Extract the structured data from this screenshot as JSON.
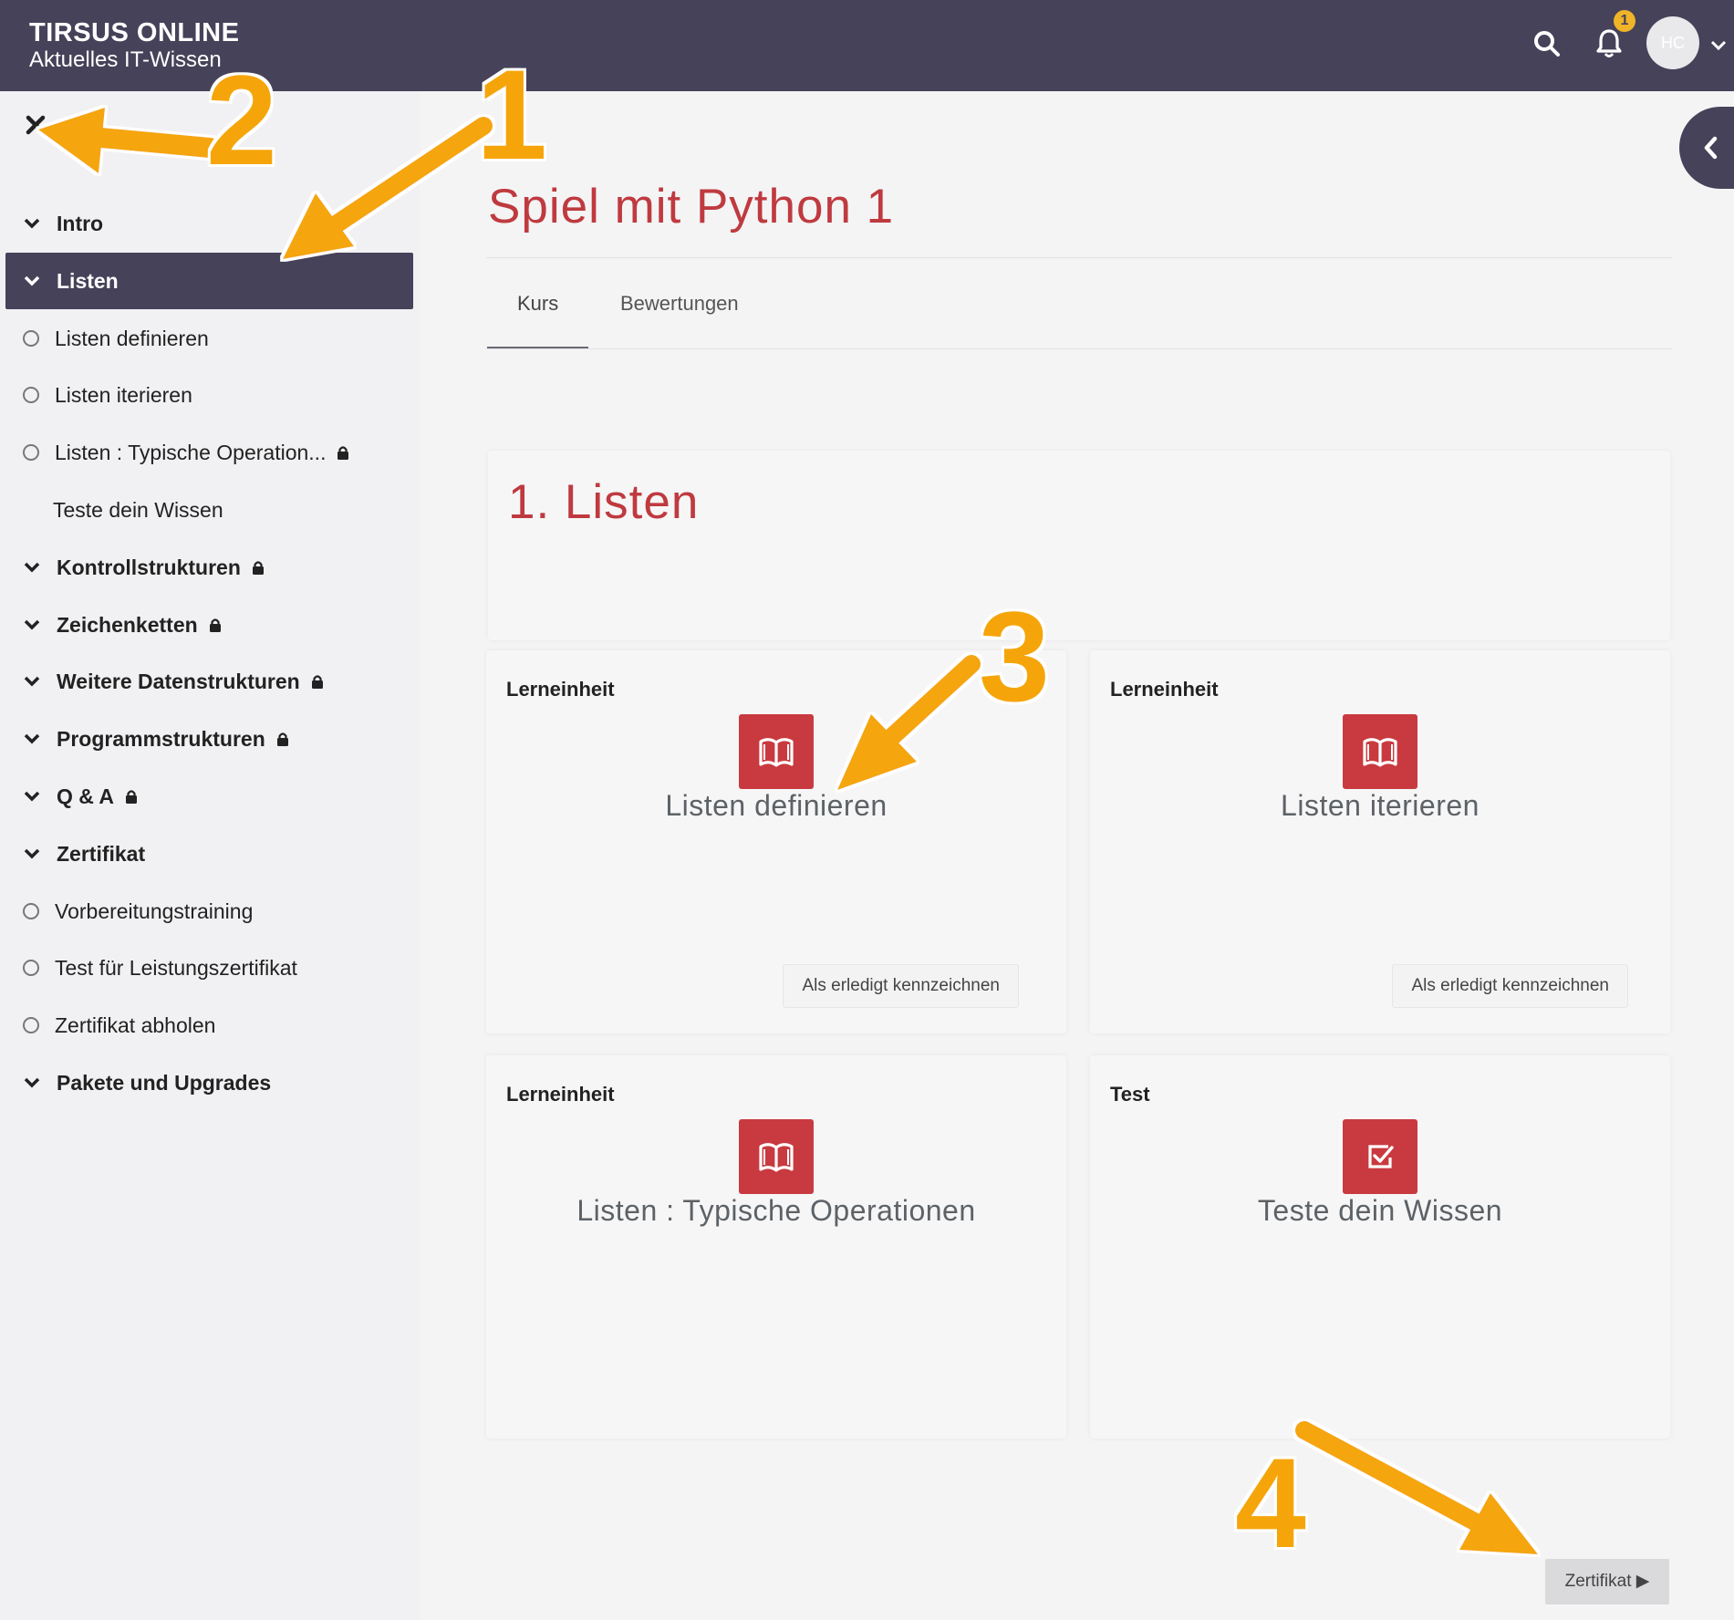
{
  "topbar": {
    "brand_title": "TIRSUS ONLINE",
    "brand_subtitle": "Aktuelles IT-Wissen",
    "notification_count": "1",
    "avatar_initials": "HC",
    "icons": [
      "search-icon",
      "bell-icon",
      "chevron-down-icon"
    ]
  },
  "sidebar": {
    "items": [
      {
        "label": "Intro",
        "kind": "section"
      },
      {
        "label": "Listen",
        "kind": "section",
        "active": true
      },
      {
        "label": "Listen definieren",
        "kind": "lesson"
      },
      {
        "label": "Listen iterieren",
        "kind": "lesson"
      },
      {
        "label": "Listen : Typische Operation...",
        "kind": "lesson",
        "locked": true
      },
      {
        "label": "Teste dein Wissen",
        "kind": "lesson-plain"
      },
      {
        "label": "Kontrollstrukturen",
        "kind": "section",
        "locked": true
      },
      {
        "label": "Zeichenketten",
        "kind": "section",
        "locked": true
      },
      {
        "label": "Weitere Datenstrukturen",
        "kind": "section",
        "locked": true
      },
      {
        "label": "Programmstrukturen",
        "kind": "section",
        "locked": true
      },
      {
        "label": "Q & A",
        "kind": "section",
        "locked": true
      },
      {
        "label": "Zertifikat",
        "kind": "section"
      },
      {
        "label": "Vorbereitungstraining",
        "kind": "lesson"
      },
      {
        "label": "Test für Leistungszertifikat",
        "kind": "lesson"
      },
      {
        "label": "Zertifikat abholen",
        "kind": "lesson"
      },
      {
        "label": "Pakete und Upgrades",
        "kind": "section"
      }
    ]
  },
  "main": {
    "course_title": "Spiel mit Python 1",
    "tabs": [
      {
        "label": "Kurs",
        "active": true
      },
      {
        "label": "Bewertungen"
      }
    ],
    "section_title": "1. Listen",
    "cards": [
      {
        "type": "Lerneinheit",
        "title": "Listen definieren",
        "button": "Als erledigt kennzeichnen",
        "icon": "book-icon"
      },
      {
        "type": "Lerneinheit",
        "title": "Listen iterieren",
        "button": "Als erledigt kennzeichnen",
        "icon": "book-icon"
      },
      {
        "type": "Lerneinheit",
        "title": "Listen : Typische Operationen",
        "icon": "book-icon"
      },
      {
        "type": "Test",
        "title": "Teste dein Wissen",
        "icon": "checkbox-icon"
      }
    ],
    "next_button": "Zertifikat ▶"
  },
  "annotations": {
    "labels": [
      "1",
      "2",
      "3",
      "4"
    ],
    "color": "#f5a50a"
  },
  "colors": {
    "topbar": "#454259",
    "accent_red": "#c83a3f",
    "title_red": "#bf3a3f",
    "annotation_orange": "#f5a50a"
  }
}
